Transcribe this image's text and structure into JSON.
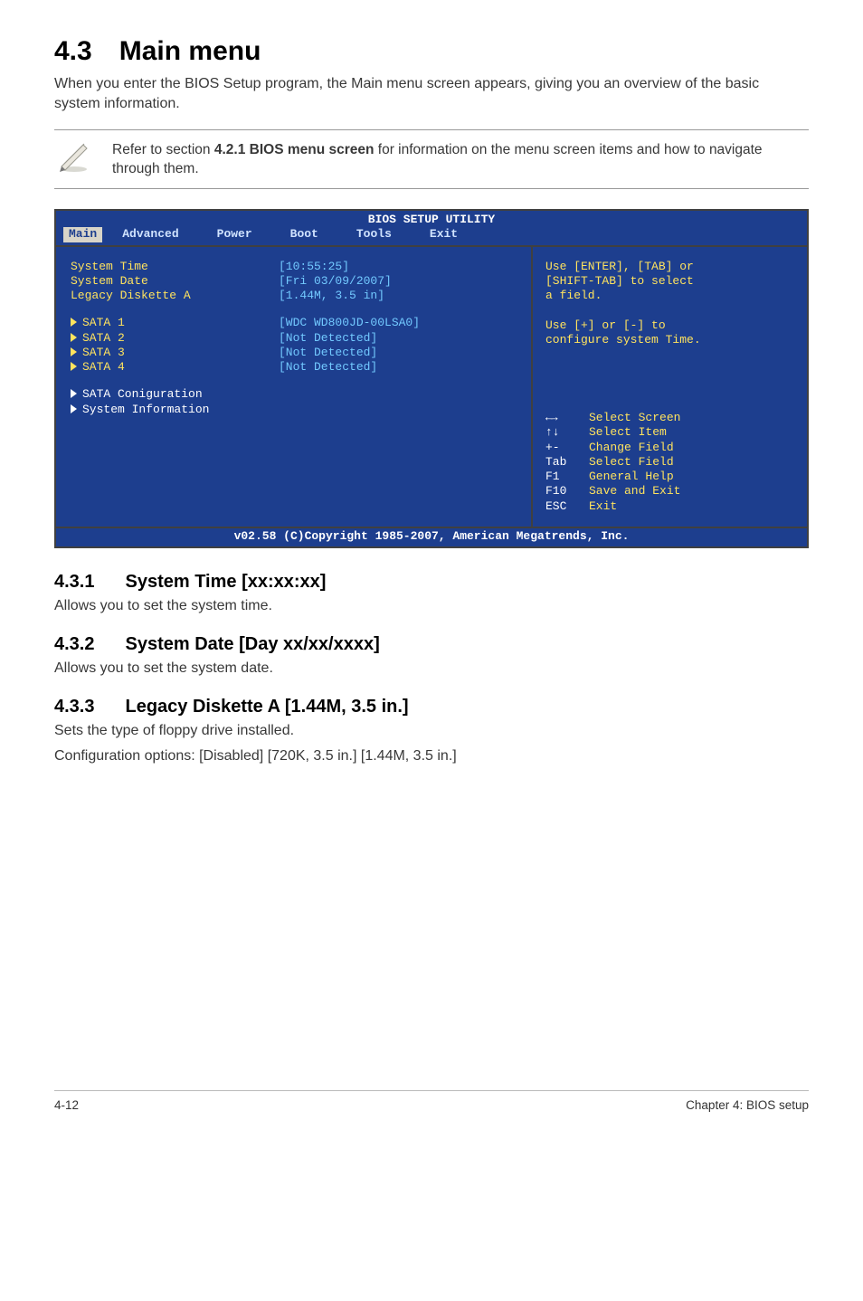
{
  "section": {
    "number": "4.3",
    "title": "Main menu",
    "intro": "When you enter the BIOS Setup program, the Main menu screen appears, giving you an overview of the basic system information."
  },
  "note": {
    "text_a": "Refer to section ",
    "text_bold": "4.2.1  BIOS menu screen",
    "text_b": " for information on the menu screen items and how to navigate through them."
  },
  "bios": {
    "title": "BIOS SETUP UTILITY",
    "menu": [
      "Main",
      "Advanced",
      "Power",
      "Boot",
      "Tools",
      "Exit"
    ],
    "selected_menu_index": 0,
    "left_rows": [
      {
        "type": "kv",
        "label": "System Time",
        "value": "[10:55:25]",
        "style": "yellow"
      },
      {
        "type": "kv",
        "label": "System Date",
        "value": "[Fri 03/09/2007]",
        "style": "yellow"
      },
      {
        "type": "kv",
        "label": "Legacy Diskette A",
        "value": "[1.44M, 3.5 in]",
        "style": "yellow"
      },
      {
        "type": "spacer"
      },
      {
        "type": "tri",
        "label": "SATA 1",
        "value": "[WDC WD800JD-00LSA0]",
        "style": "yellow"
      },
      {
        "type": "tri",
        "label": "SATA 2",
        "value": "[Not Detected]",
        "style": "yellow"
      },
      {
        "type": "tri",
        "label": "SATA 3",
        "value": "[Not Detected]",
        "style": "yellow"
      },
      {
        "type": "tri",
        "label": "SATA 4",
        "value": "[Not Detected]",
        "style": "yellow"
      },
      {
        "type": "spacer"
      },
      {
        "type": "tri",
        "label": "SATA Coniguration",
        "value": "",
        "style": "white"
      },
      {
        "type": "tri",
        "label": "System Information",
        "value": "",
        "style": "white"
      }
    ],
    "right_top": [
      "Use [ENTER], [TAB] or",
      "[SHIFT-TAB] to select",
      "a field.",
      "",
      "Use [+] or [-] to",
      "configure system Time."
    ],
    "help_keys": [
      {
        "key_icon": "lr",
        "label": "Select Screen"
      },
      {
        "key_icon": "ud",
        "label": "Select Item"
      },
      {
        "key": "+-",
        "label": "Change Field"
      },
      {
        "key": "Tab",
        "label": "Select Field"
      },
      {
        "key": "F1",
        "label": "General Help"
      },
      {
        "key": "F10",
        "label": "Save and Exit"
      },
      {
        "key": "ESC",
        "label": "Exit"
      }
    ],
    "footer": "v02.58 (C)Copyright 1985-2007, American Megatrends, Inc."
  },
  "subsections": [
    {
      "num": "4.3.1",
      "title": "System Time [xx:xx:xx]",
      "lines": [
        "Allows you to set the system time."
      ]
    },
    {
      "num": "4.3.2",
      "title": "System Date [Day xx/xx/xxxx]",
      "lines": [
        "Allows you to set the system date."
      ]
    },
    {
      "num": "4.3.3",
      "title": "Legacy Diskette A [1.44M, 3.5 in.]",
      "lines": [
        "Sets the type of floppy drive installed.",
        "Configuration options: [Disabled] [720K, 3.5 in.] [1.44M, 3.5 in.]"
      ]
    }
  ],
  "footer": {
    "left": "4-12",
    "right": "Chapter 4: BIOS setup"
  }
}
